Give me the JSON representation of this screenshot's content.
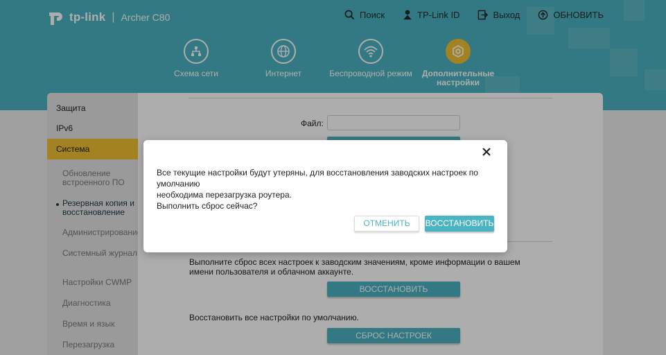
{
  "colors": {
    "accent": "#4cb3c2",
    "highlight": "#f1c232"
  },
  "header": {
    "brand": "tp-link",
    "separator": "|",
    "model": "Archer C80",
    "topnav": [
      {
        "label": "Поиск",
        "icon": "search-icon"
      },
      {
        "label": "TP-Link ID",
        "icon": "tplink-id-icon"
      },
      {
        "label": "Выход",
        "icon": "logout-icon"
      },
      {
        "label": "ОБНОВИТЬ",
        "icon": "update-icon"
      }
    ],
    "tabs": [
      {
        "label": "Схема сети",
        "icon": "network-map-icon"
      },
      {
        "label": "Интернет",
        "icon": "globe-icon"
      },
      {
        "label": "Беспроводной режим",
        "icon": "wifi-icon"
      },
      {
        "label": "Дополнительные настройки",
        "icon": "gear-icon",
        "active": true
      }
    ]
  },
  "sidebar": {
    "items": [
      "Защита",
      "IPv6",
      "Система"
    ],
    "sub_items": [
      "Обновление встроенного ПО",
      "Резервная копия и восстановление",
      "Администрирование",
      "Системный журнал",
      "Настройки CWMP",
      "Диагностика",
      "Время и язык",
      "Перезагрузка"
    ]
  },
  "content": {
    "file_label": "Файл:",
    "factory_text": "Выполните сброс всех настроек к заводским значениям, кроме информации о вашем имени пользователя и облачном аккаунте.",
    "restore_button": "ВОССТАНОВИТЬ",
    "default_text": "Восстановить все настройки по умолчанию.",
    "reset_button": "СБРОС НАСТРОЕК"
  },
  "dialog": {
    "line1": "Все текущие настройки будут утеряны, для восстановления заводских настроек по умолчанию",
    "line2": "необходима перезагрузка роутера.",
    "line3": "Выполнить сброс сейчас?",
    "cancel": "ОТМЕНИТЬ",
    "confirm": "ВОССТАНОВИТЬ"
  }
}
